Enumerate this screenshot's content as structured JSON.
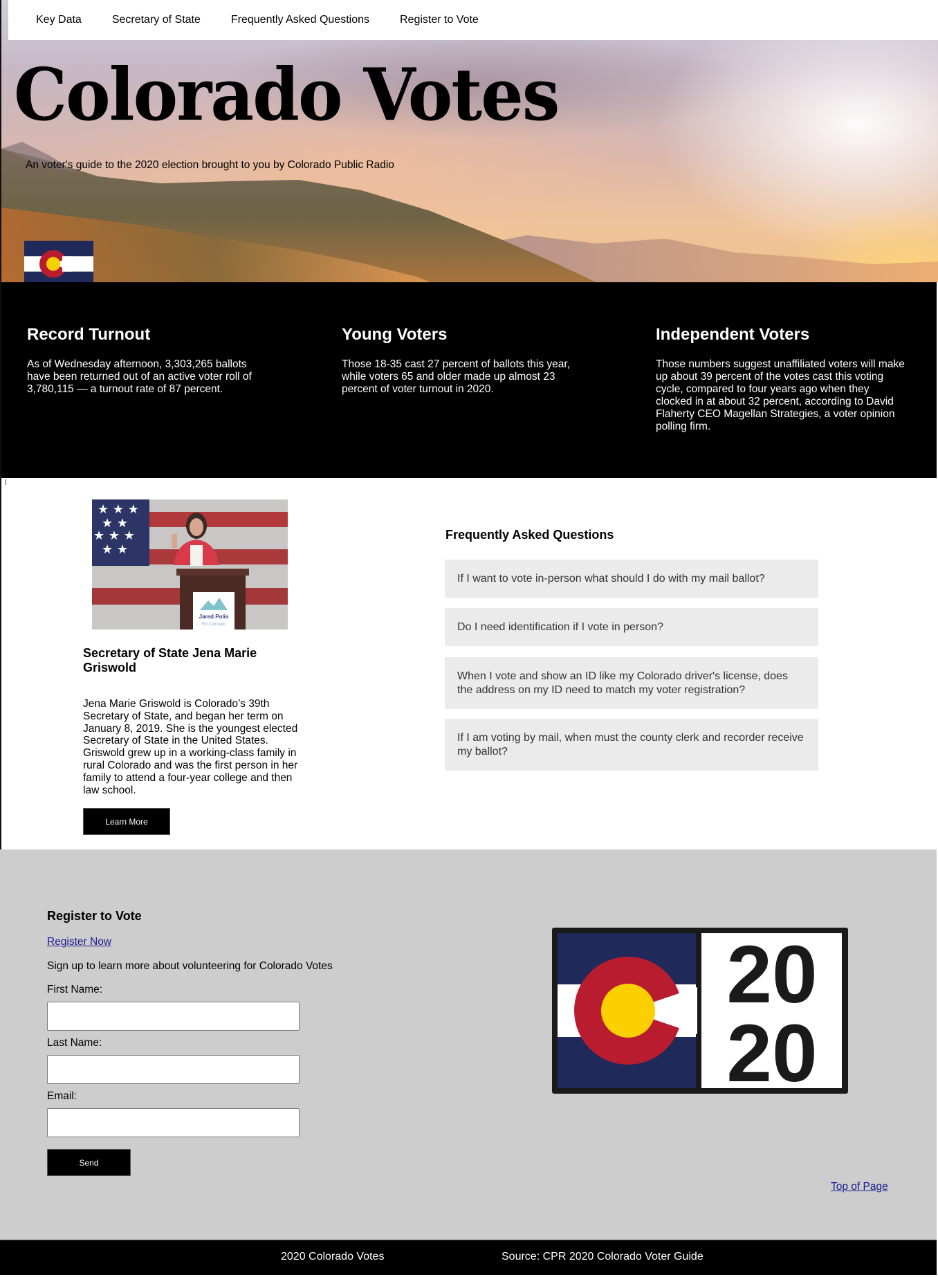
{
  "nav": {
    "items": [
      {
        "label": "Key Data"
      },
      {
        "label": "Secretary of State"
      },
      {
        "label": "Frequently Asked Questions"
      },
      {
        "label": "Register to Vote"
      }
    ]
  },
  "hero": {
    "title": "Colorado Votes",
    "subtitle": "An voter's guide to the 2020 election brought to you by Colorado Public Radio",
    "flag_icon": "colorado-flag-icon"
  },
  "key_data": {
    "cards": [
      {
        "title": "Record Turnout",
        "body": "As of Wednesday afternoon, 3,303,265 ballots have been returned out of an active voter roll of 3,780,115 — a turnout rate of 87 percent."
      },
      {
        "title": "Young Voters",
        "body": "Those 18-35 cast 27 percent of ballots this year, while voters 65 and older made up almost 23 percent of voter turnout in 2020."
      },
      {
        "title": "Independent Voters",
        "body": "Those numbers suggest unaffiliated voters will make up about 39 percent of the votes cast this voting cycle, compared to four years ago when they clocked in at about 32 percent, according to David Flaherty CEO Magellan Strategies, a voter opinion polling firm."
      }
    ]
  },
  "secretary": {
    "photo_sign_text": "Jared Polis",
    "photo_sign_subtext": "For Colorado",
    "name": "Secretary of State Jena Marie Griswold",
    "bio": "Jena Marie Griswold is Colorado’s 39th Secretary of State, and began her term on January 8, 2019. She is the youngest elected Secretary of State in the United States. Griswold grew up in a working-class family in rural Colorado and was the first person in her family to attend a four-year college and then law school.",
    "learn_more_label": "Learn More"
  },
  "faq": {
    "title": "Frequently Asked Questions",
    "items": [
      {
        "question": "If I want to vote in-person what should I do with my mail ballot?"
      },
      {
        "question": "Do I need identification if I vote in person?"
      },
      {
        "question": "When I vote and show an ID like my Colorado driver's license, does the address on my ID need to match my voter registration?"
      },
      {
        "question": "If I am voting by mail, when must the county clerk and recorder receive my ballot?"
      }
    ]
  },
  "register": {
    "title": "Register to Vote",
    "register_link": "Register Now",
    "subtitle": "Sign up to learn more about volunteering for Colorado Votes",
    "fields": [
      {
        "label": "First Name:",
        "value": ""
      },
      {
        "label": "Last Name:",
        "value": ""
      },
      {
        "label": "Email:",
        "value": ""
      }
    ],
    "send_label": "Send",
    "logo_text_top": "20",
    "logo_text_bottom": "20",
    "top_link": "Top of Page"
  },
  "footer": {
    "left": "2020 Colorado Votes",
    "right": "Source: CPR 2020 Colorado Voter Guide"
  },
  "colors": {
    "flag_blue": "#1f2a5a",
    "flag_red": "#b91c2e",
    "flag_gold": "#fcd000",
    "faq_bg": "#ebebeb",
    "register_bg": "#cdcdcd",
    "link": "#1a1a8c"
  }
}
